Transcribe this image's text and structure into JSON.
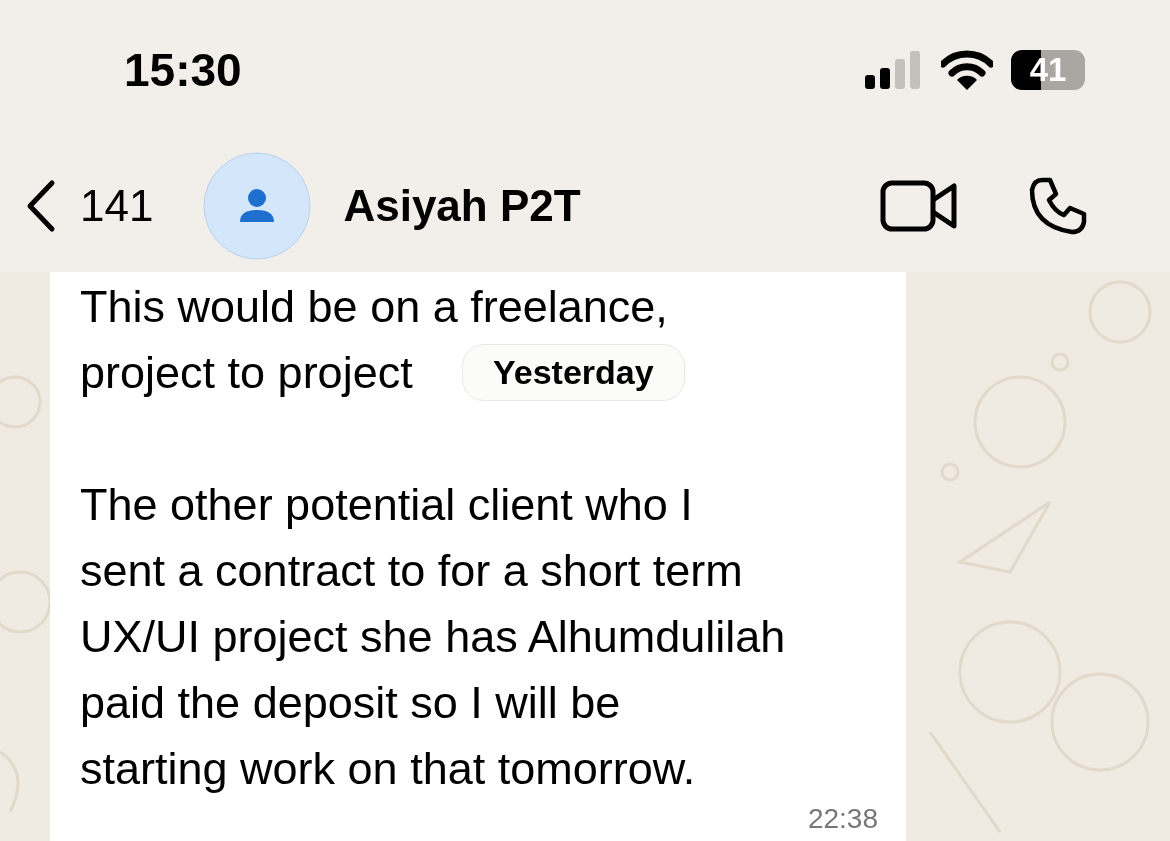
{
  "status_bar": {
    "time": "15:30",
    "battery": {
      "reading": "41",
      "level": 0.41
    }
  },
  "header": {
    "back_count": "141",
    "contact_name": "Asiyah P2T"
  },
  "date_chip": "Yesterday",
  "message": {
    "paragraphs": [
      {
        "lines": [
          "This would be on a freelance,",
          "project to project"
        ]
      },
      {
        "lines": [
          "The other potential client who I",
          "sent a contract to for a short term",
          "UX/UI project she has Alhumdulilah",
          "paid the deposit so I will be",
          "starting work on that tomorrow."
        ]
      }
    ],
    "time": "22:38"
  }
}
